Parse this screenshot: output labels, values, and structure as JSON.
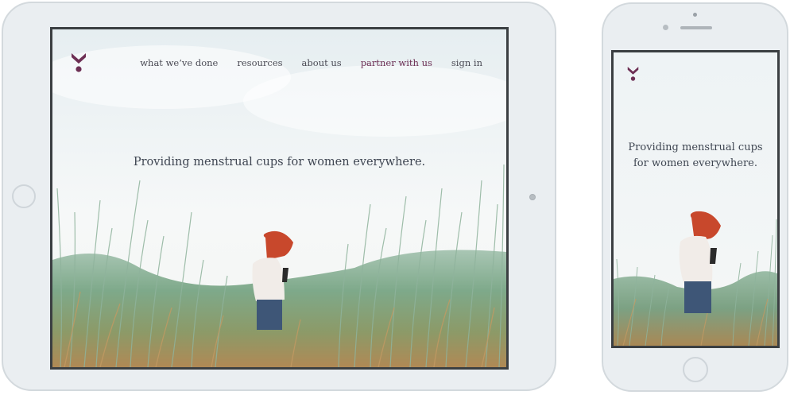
{
  "brand": {
    "logo_icon": "venus-chevron-logo-icon",
    "color": "#6d2f54"
  },
  "tablet": {
    "nav": [
      {
        "label": "what we’ve done"
      },
      {
        "label": "resources"
      },
      {
        "label": "about us"
      },
      {
        "label": "partner with us",
        "accent": true
      },
      {
        "label": "sign in"
      }
    ],
    "tagline": "Providing menstrual cups for women everywhere."
  },
  "phone": {
    "tagline": "Providing menstrual cups for women everywhere."
  },
  "hero_image": {
    "subject": "woman-with-red-hair-in-tall-grass-field"
  }
}
